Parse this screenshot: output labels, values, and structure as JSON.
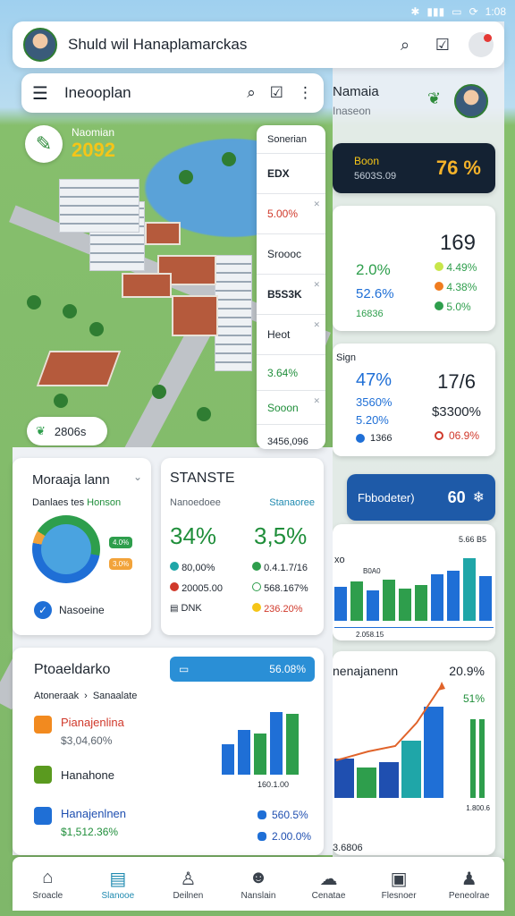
{
  "status": {
    "time": "1:08"
  },
  "header": {
    "title": "Shuld wil Hanaplamarckas"
  },
  "search": {
    "title": "Ineooplan"
  },
  "project": {
    "label": "Naomian",
    "year": "2092"
  },
  "map_pill": {
    "label": "2806s"
  },
  "stat_column": {
    "items": [
      "Sonerian",
      "EDX",
      "5.00%",
      "Sroooc",
      "B5S3K",
      "Heot",
      "3.64%",
      "Sooon",
      "3456,096"
    ]
  },
  "right_header": {
    "title": "Namaia",
    "subtitle": "Inaseon"
  },
  "right_banner": {
    "label": "Boon",
    "sub": "5603S.09",
    "value": "76 %"
  },
  "right_card1": {
    "big": "169",
    "rows": [
      {
        "value": "2.0%",
        "badge": "4.49%"
      },
      {
        "value": "52.6%",
        "badge": "4.38%"
      },
      {
        "value": "16836",
        "badge": "5.0%"
      }
    ]
  },
  "right_card2": {
    "title": "Sign",
    "left_big": "47%",
    "right_big": "17/6",
    "rows": [
      {
        "a": "3560%",
        "b": "$3300%"
      },
      {
        "a": "5.20%",
        "b": "06.9%"
      }
    ],
    "foot": "1366"
  },
  "right_button": {
    "label": "Fbbodeter)",
    "value": "60"
  },
  "right_bar_card": {
    "title": "xo",
    "top": "5.66 B5",
    "legend": "B0A0",
    "foot": "2.058.15"
  },
  "right_line_card": {
    "title": "nenajanenn",
    "value": "20.9%",
    "side": "51%",
    "axis": "1.800.6",
    "foot": "3.6806"
  },
  "mgmt_card": {
    "title": "Moraaja lann",
    "subtitle": "Danlaes tes",
    "tag": "Honson",
    "chip1": "4.0%",
    "chip2": "3.0%",
    "footer": "Nasoeine"
  },
  "stats_card": {
    "title": "STANSTE",
    "subtitle": "Nanoedoee",
    "link": "Stanaoree",
    "big_left": "34%",
    "big_right": "3,5%",
    "rows": [
      {
        "left": "80,00%",
        "right": "0.4.1.7/16"
      },
      {
        "left": "20005.00",
        "right": "568.167%"
      },
      {
        "left": "DNK",
        "right": "236.20%"
      }
    ]
  },
  "proj_card": {
    "title": "Ptoaeldarko",
    "badge": "56.08%",
    "crumb1": "Atoneraak",
    "crumb2": "Sanaalate",
    "items": [
      {
        "name": "Pianajenlina",
        "value": "$3,04,60%"
      },
      {
        "name": "Hanahone",
        "value": ""
      },
      {
        "name": "Hanajenlnen",
        "value": "$1,512.36%"
      }
    ],
    "chart_label": "160.1.00",
    "right_vals": [
      "560.5%",
      "2.00.0%"
    ]
  },
  "nav": {
    "items": [
      "Sroacle",
      "Slanooe",
      "Deilnen",
      "Nanslain",
      "Cenatae",
      "Flesnoer",
      "Peneolrae"
    ]
  }
}
